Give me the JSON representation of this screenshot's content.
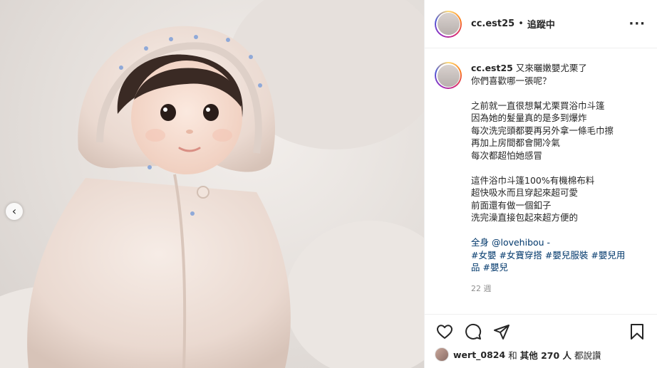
{
  "post": {
    "username": "cc.est25",
    "follow_label": "追蹤中",
    "more_label": "···",
    "prev_label": "‹",
    "caption_lines": [
      "又來曬嫩嬰尤栗了",
      "你們喜歡哪一張呢？",
      "",
      "之前就一直很想幫尤栗買浴巾斗篷",
      "因為她的髮量真的是多到爆炸",
      "每次洗完頭都要再另外拿一條毛巾擦",
      "再加上房間都會開冷氣",
      "每次都超怕她感冒",
      "",
      "這件浴巾斗篷100%有機棉布料",
      "超快吸水而且穿起來超可愛",
      "前面還有做一個釦子",
      "洗完澡直接包起來超方便的",
      "",
      "全身 @lovehibou -"
    ],
    "hashtags_line1": "#女嬰 #女寶穿搭 #嬰兒服裝 #嬰兒用",
    "hashtags_line2": "品 #嬰兒",
    "time_ago": "22 週",
    "likes": {
      "user": "wert_0824",
      "and": "和",
      "others_label": "其他 270 人",
      "suffix": "都說讚"
    }
  },
  "icons": {
    "like": "heart-icon",
    "comment": "comment-icon",
    "share": "paper-plane-icon",
    "save": "bookmark-icon",
    "prev": "chevron-left-icon"
  }
}
